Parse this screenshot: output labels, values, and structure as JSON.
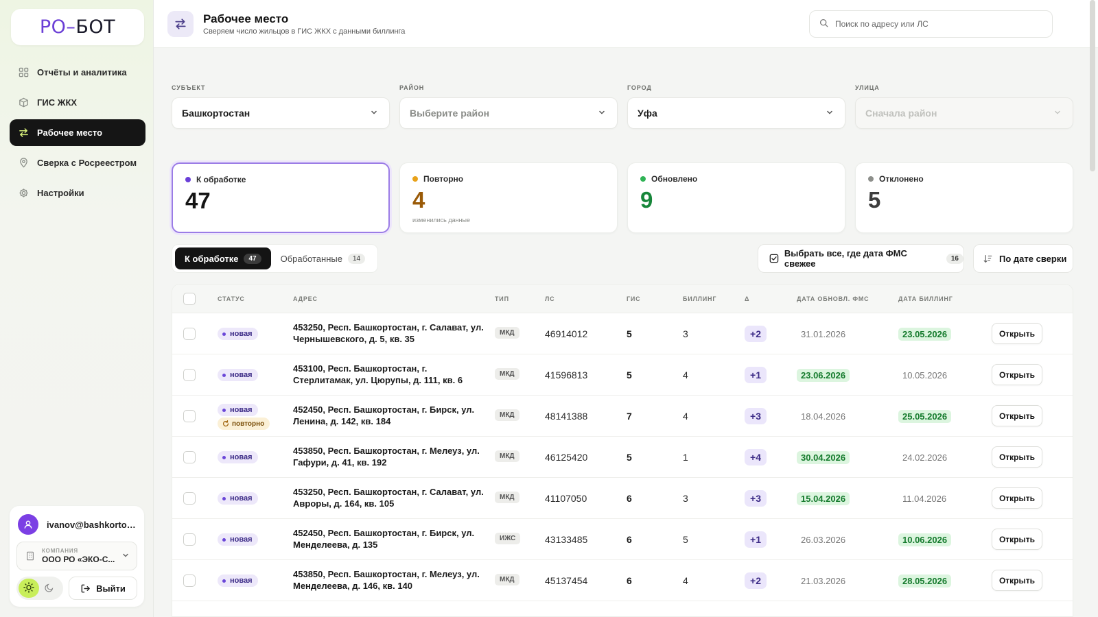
{
  "app": {
    "logo_left": "РО",
    "logo_dash": "–",
    "logo_right": "БОТ"
  },
  "sidebar": {
    "items": [
      {
        "label": "Отчёты и аналитика",
        "icon": "grid-icon"
      },
      {
        "label": "ГИС ЖКХ",
        "icon": "box-icon"
      },
      {
        "label": "Рабочее место",
        "icon": "swap-icon",
        "active": true
      },
      {
        "label": "Сверка с Росреестром",
        "icon": "map-pin-icon"
      },
      {
        "label": "Настройки",
        "icon": "gear-icon"
      }
    ],
    "user": {
      "email": "ivanov@bashkortost...",
      "company_label": "КОМПАНИЯ",
      "company_name": "ООО РО «ЭКО-С..."
    },
    "logout_label": "Выйти"
  },
  "header": {
    "title": "Рабочее место",
    "subtitle": "Сверяем число жильцов в ГИС ЖКХ с данными биллинга",
    "search_placeholder": "Поиск по адресу или ЛС"
  },
  "filters": [
    {
      "label": "СУБЪЕКТ",
      "value": "Башкортостан",
      "state": "value"
    },
    {
      "label": "РАЙОН",
      "value": "Выберите район",
      "state": "placeholder"
    },
    {
      "label": "ГОРОД",
      "value": "Уфа",
      "state": "value"
    },
    {
      "label": "УЛИЦА",
      "value": "Сначала район",
      "state": "disabled"
    }
  ],
  "stats": [
    {
      "label": "К обработке",
      "value": "47",
      "note": "",
      "dot_color": "#6a3fd8",
      "value_color": "#151515"
    },
    {
      "label": "Повторно",
      "value": "4",
      "note": "изменились данные",
      "dot_color": "#e8a21a",
      "value_color": "#9a5a07"
    },
    {
      "label": "Обновлено",
      "value": "9",
      "note": "",
      "dot_color": "#2fb355",
      "value_color": "#17863a"
    },
    {
      "label": "Отклонено",
      "value": "5",
      "note": "",
      "dot_color": "#8d8f8b",
      "value_color": "#3d3d3d"
    }
  ],
  "tabs": [
    {
      "label": "К обработке",
      "count": "47"
    },
    {
      "label": "Обработанные",
      "count": "14"
    }
  ],
  "actions": {
    "select_all_label": "Выбрать все, где дата ФМС свежее",
    "select_all_count": "16",
    "sort_label": "По дате сверки"
  },
  "table": {
    "columns": [
      "СТАТУС",
      "АДРЕС",
      "ТИП",
      "ЛС",
      "ГИС",
      "БИЛЛИНГ",
      "Δ",
      "ДАТА ОБНОВЛ. ФМС",
      "ДАТА БИЛЛИНГ"
    ],
    "open_label": "Открыть",
    "repeat_label": "повторно",
    "rows": [
      {
        "status": "новая",
        "address": "453250, Респ. Башкортостан, г. Салават, ул. Чернышевского, д. 5, кв. 35",
        "type": "МКД",
        "ls": "46914012",
        "gis": "5",
        "billing": "3",
        "delta": "+2",
        "fms_date": "31.01.2026",
        "bill_date": "23.05.2026",
        "fresh": "bill"
      },
      {
        "status": "новая",
        "address": "453100, Респ. Башкортостан, г. Стерлитамак, ул. Цюрупы, д. 111, кв. 6",
        "type": "МКД",
        "ls": "41596813",
        "gis": "5",
        "billing": "4",
        "delta": "+1",
        "fms_date": "23.06.2026",
        "bill_date": "10.05.2026",
        "fresh": "fms"
      },
      {
        "status": "новая",
        "repeat": true,
        "address": "452450, Респ. Башкортостан, г. Бирск, ул. Ленина, д. 142, кв. 184",
        "type": "МКД",
        "ls": "48141388",
        "gis": "7",
        "billing": "4",
        "delta": "+3",
        "fms_date": "18.04.2026",
        "bill_date": "25.05.2026",
        "fresh": "bill"
      },
      {
        "status": "новая",
        "address": "453850, Респ. Башкортостан, г. Мелеуз, ул. Гафури, д. 41, кв. 192",
        "type": "МКД",
        "ls": "46125420",
        "gis": "5",
        "billing": "1",
        "delta": "+4",
        "fms_date": "30.04.2026",
        "bill_date": "24.02.2026",
        "fresh": "fms"
      },
      {
        "status": "новая",
        "address": "453250, Респ. Башкортостан, г. Салават, ул. Авроры, д. 164, кв. 105",
        "type": "МКД",
        "ls": "41107050",
        "gis": "6",
        "billing": "3",
        "delta": "+3",
        "fms_date": "15.04.2026",
        "bill_date": "11.04.2026",
        "fresh": "fms"
      },
      {
        "status": "новая",
        "address": "452450, Респ. Башкортостан, г. Бирск, ул. Менделеева, д. 135",
        "type": "ИЖС",
        "ls": "43133485",
        "gis": "6",
        "billing": "5",
        "delta": "+1",
        "fms_date": "26.03.2026",
        "bill_date": "10.06.2026",
        "fresh": "bill"
      },
      {
        "status": "новая",
        "address": "453850, Респ. Башкортостан, г. Мелеуз, ул. Менделеева, д. 146, кв. 140",
        "type": "МКД",
        "ls": "45137454",
        "gis": "6",
        "billing": "4",
        "delta": "+2",
        "fms_date": "21.03.2026",
        "bill_date": "28.05.2026",
        "fresh": "bill"
      }
    ]
  }
}
